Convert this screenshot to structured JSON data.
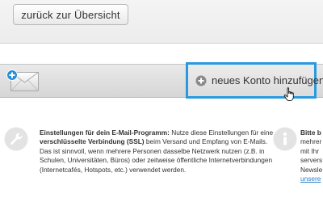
{
  "toolbar": {
    "back_label": "zurück zur Übersicht"
  },
  "accounts": {
    "add_label": "neues Konto hinzufügen",
    "highlight_color": "#2a9ae0"
  },
  "info_left": {
    "title": "Einstellungen für dein E-Mail-Programm:",
    "text_1": " Nutze diese Einstellungen für eine ",
    "emph": "verschlüsselte Verbindung (SSL)",
    "text_2": " beim Versand und Empfang von E-Mails. Das ist sinnvoll, wenn mehrere Personen dasselbe Netzwerk nutzen (z.B. in Schulen, Universitäten, Büros) oder zeitweise öffentliche Internetverbindungen (Internetcafés, Hotspots, etc.) verwendet werden."
  },
  "info_right": {
    "lines": [
      "Bitte b",
      "mehrer al",
      "mit Ihr",
      "servers",
      "Newsle",
      "unsere"
    ],
    "link_color": "#2a7fc7"
  },
  "icons": {
    "mail": "envelope-icon",
    "add": "plus-circle-icon",
    "settings": "wrench-icon",
    "info": "info-icon",
    "cursor": "hand-cursor-icon"
  }
}
